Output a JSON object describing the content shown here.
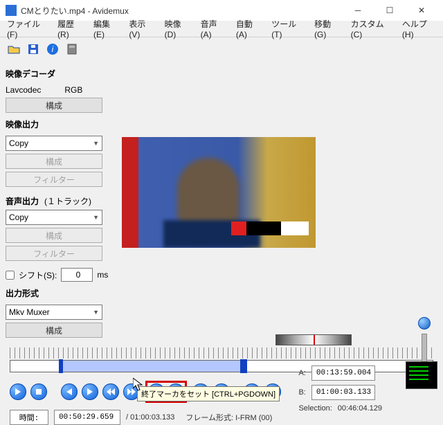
{
  "window": {
    "title": "CMとりたい.mp4 - Avidemux"
  },
  "menu": {
    "file": "ファイル(F)",
    "recent": "履歴(R)",
    "edit": "編集(E)",
    "view": "表示(V)",
    "video": "映像(D)",
    "audio": "音声(A)",
    "auto": "自動(A)",
    "tools": "ツール(T)",
    "go": "移動(G)",
    "custom": "カスタム(C)",
    "help": "ヘルプ(H)"
  },
  "decoder": {
    "title": "映像デコーダ",
    "left": "Lavcodec",
    "right": "RGB",
    "config": "構成"
  },
  "video_out": {
    "title": "映像出力",
    "codec": "Copy",
    "config": "構成",
    "filter": "フィルター"
  },
  "audio_out": {
    "title": "音声出力",
    "tracks": "(１トラック)",
    "codec": "Copy",
    "config": "構成",
    "filter": "フィルター",
    "shift_label": "シフト(S):",
    "shift_value": "0",
    "shift_unit": "ms"
  },
  "format": {
    "title": "出力形式",
    "muxer": "Mkv Muxer",
    "config": "構成"
  },
  "tooltip": "終了マーカをセット [CTRL+PGDOWN]",
  "markers": {
    "a_label": "A:",
    "a_value": "00:13:59.004",
    "b_label": "B:",
    "b_value": "01:00:03.133",
    "sel_label": "Selection:",
    "sel_value": "00:46:04.129"
  },
  "time": {
    "label": "時間:",
    "current": "00:50:29.659",
    "total": "/ 01:00:03.133",
    "frame": "フレーム形式: I-FRM (00)"
  }
}
